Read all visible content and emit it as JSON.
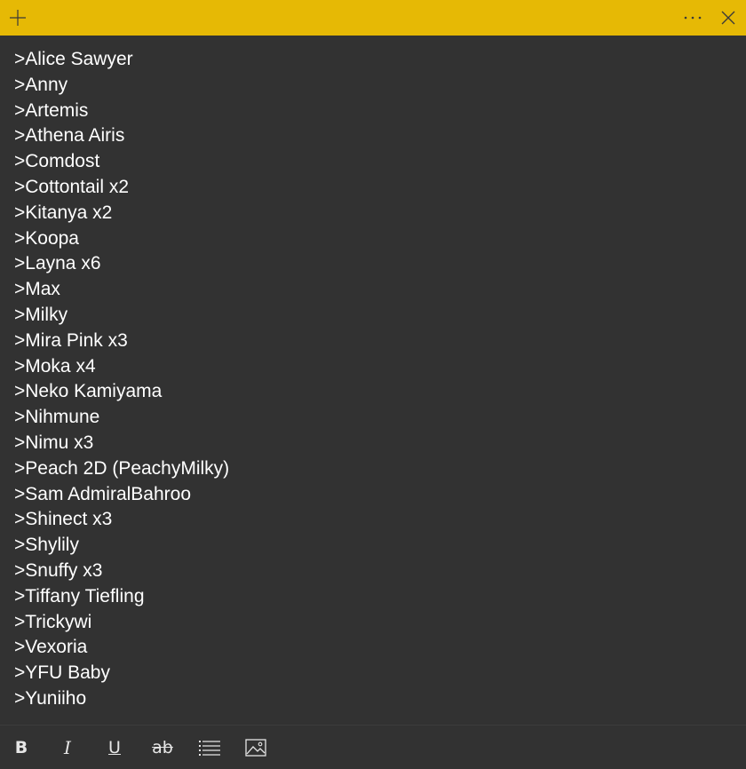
{
  "window": {
    "accent": "#e6b905",
    "background": "#323232",
    "text_color": "#ffffff"
  },
  "titlebar": {
    "add_icon": "plus-icon",
    "more_icon": "more-ellipsis-icon",
    "close_icon": "close-icon"
  },
  "note": {
    "lines": [
      ">Alice Sawyer",
      ">Anny",
      ">Artemis",
      ">Athena Airis",
      ">Comdost",
      ">Cottontail x2",
      ">Kitanya x2",
      ">Koopa",
      ">Layna x6",
      ">Max",
      ">Milky",
      ">Mira Pink x3",
      ">Moka x4",
      ">Neko Kamiyama",
      ">Nihmune",
      ">Nimu x3",
      ">Peach 2D (PeachyMilky)",
      ">Sam AdmiralBahroo",
      ">Shinect x3",
      ">Shylily",
      ">Snuffy x3",
      ">Tiffany Tiefling",
      ">Trickywi",
      ">Vexoria",
      ">YFU Baby",
      ">Yuniiho"
    ]
  },
  "toolbar": {
    "bold_label": "B",
    "italic_label": "I",
    "underline_label": "U",
    "strikethrough_label": "ab",
    "list_icon": "bulleted-list-icon",
    "image_icon": "image-icon"
  }
}
